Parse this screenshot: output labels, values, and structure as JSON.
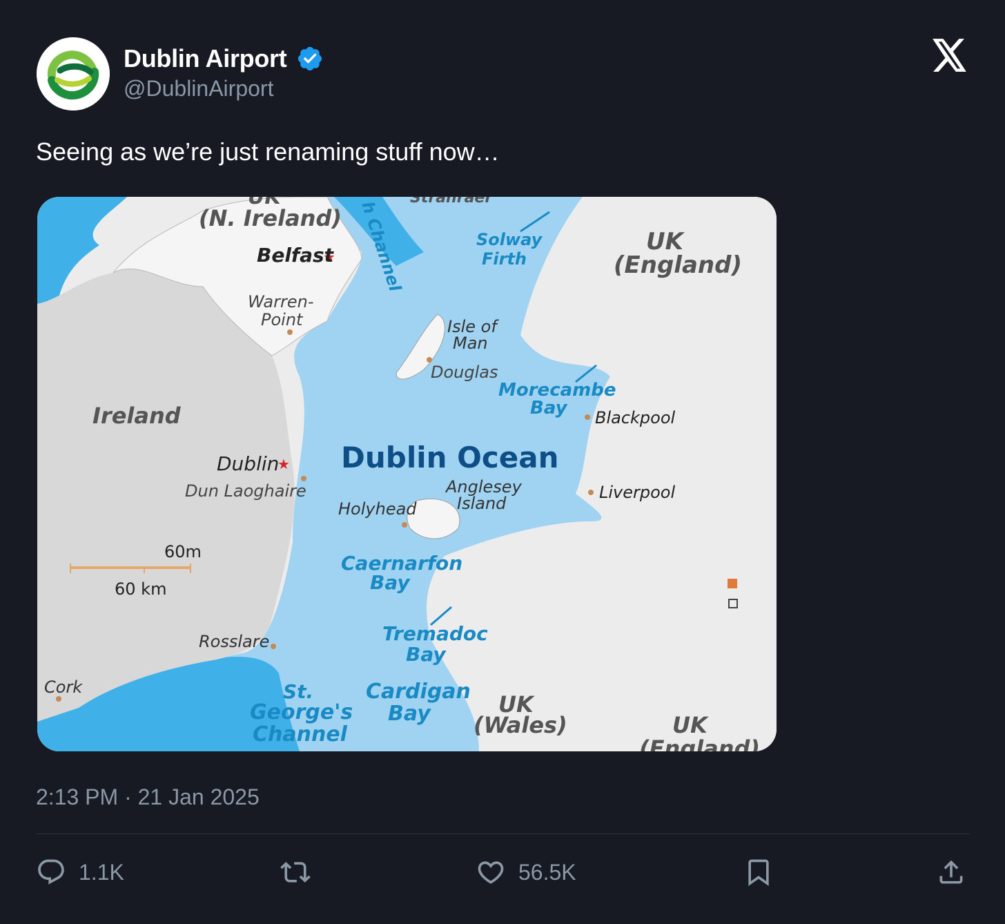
{
  "author": {
    "display_name": "Dublin Airport",
    "handle": "@DublinAirport",
    "verified": true,
    "verified_color": "#1d9bf0"
  },
  "tweet": {
    "text": "Seeing as we’re just renaming stuff now…",
    "timestamp": "2:13 PM · 21 Jan 2025"
  },
  "map": {
    "labels": {
      "n_ireland_top": "UK",
      "n_ireland": "(N. Ireland)",
      "north_channel": "h Channel",
      "stranraer": "Stranraer",
      "belfast": "Belfast",
      "warren_1": "Warren-",
      "warren_2": "Point",
      "solway_1": "Solway",
      "solway_2": "Firth",
      "uk_england_1": "UK",
      "uk_england_2": "(England)",
      "isle_of_man_1": "Isle of",
      "isle_of_man_2": "Man",
      "douglas": "Douglas",
      "morecambe_1": "Morecambe",
      "morecambe_2": "Bay",
      "blackpool": "Blackpool",
      "ireland": "Ireland",
      "dublin": "Dublin",
      "dun_laoghaire": "Dun Laoghaire",
      "dublin_ocean": "Dublin Ocean",
      "anglesey_1": "Anglesey",
      "anglesey_2": "Island",
      "holyhead": "Holyhead",
      "liverpool": "Liverpool",
      "scale_miles": "60m",
      "scale_km": "60 km",
      "caernarfon_1": "Caernarfon",
      "caernarfon_2": "Bay",
      "tremadoc_1": "Tremadoc",
      "tremadoc_2": "Bay",
      "rosslare": "Rosslare",
      "cork": "Cork",
      "st_georges_1": "St.",
      "st_georges_2": "George's",
      "st_georges_3": "Channel",
      "cardigan_1": "Cardigan",
      "cardigan_2": "Bay",
      "uk_wales_1": "UK",
      "uk_wales_2": "(Wales)",
      "uk_england_s_1": "UK",
      "uk_england_s_2": "(England)"
    },
    "colors": {
      "sea": "#9fd3f1",
      "deep_sea": "#3fb0e8",
      "land": "#ececec",
      "ireland_land": "#d8d8d8",
      "water_text": "#1a8ac4",
      "ocean_text": "#0d4e86",
      "city_star": "#d6242b"
    }
  },
  "actions": {
    "replies": "1.1K",
    "likes": "56.5K"
  },
  "icons": [
    "avatar-logo",
    "verified-badge-icon",
    "x-logo-icon",
    "reply-icon",
    "retweet-icon",
    "like-icon",
    "bookmark-icon",
    "share-icon"
  ]
}
